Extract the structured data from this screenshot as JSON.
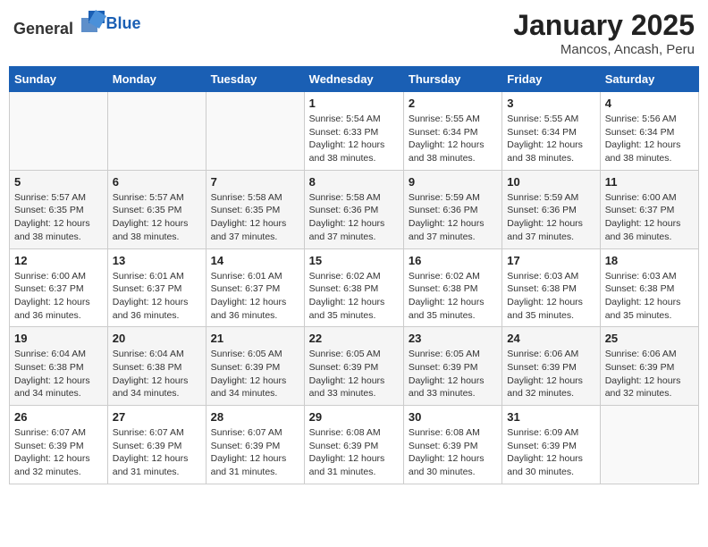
{
  "header": {
    "logo_general": "General",
    "logo_blue": "Blue",
    "month": "January 2025",
    "location": "Mancos, Ancash, Peru"
  },
  "weekdays": [
    "Sunday",
    "Monday",
    "Tuesday",
    "Wednesday",
    "Thursday",
    "Friday",
    "Saturday"
  ],
  "weeks": [
    [
      {
        "day": "",
        "info": ""
      },
      {
        "day": "",
        "info": ""
      },
      {
        "day": "",
        "info": ""
      },
      {
        "day": "1",
        "info": "Sunrise: 5:54 AM\nSunset: 6:33 PM\nDaylight: 12 hours\nand 38 minutes."
      },
      {
        "day": "2",
        "info": "Sunrise: 5:55 AM\nSunset: 6:34 PM\nDaylight: 12 hours\nand 38 minutes."
      },
      {
        "day": "3",
        "info": "Sunrise: 5:55 AM\nSunset: 6:34 PM\nDaylight: 12 hours\nand 38 minutes."
      },
      {
        "day": "4",
        "info": "Sunrise: 5:56 AM\nSunset: 6:34 PM\nDaylight: 12 hours\nand 38 minutes."
      }
    ],
    [
      {
        "day": "5",
        "info": "Sunrise: 5:57 AM\nSunset: 6:35 PM\nDaylight: 12 hours\nand 38 minutes."
      },
      {
        "day": "6",
        "info": "Sunrise: 5:57 AM\nSunset: 6:35 PM\nDaylight: 12 hours\nand 38 minutes."
      },
      {
        "day": "7",
        "info": "Sunrise: 5:58 AM\nSunset: 6:35 PM\nDaylight: 12 hours\nand 37 minutes."
      },
      {
        "day": "8",
        "info": "Sunrise: 5:58 AM\nSunset: 6:36 PM\nDaylight: 12 hours\nand 37 minutes."
      },
      {
        "day": "9",
        "info": "Sunrise: 5:59 AM\nSunset: 6:36 PM\nDaylight: 12 hours\nand 37 minutes."
      },
      {
        "day": "10",
        "info": "Sunrise: 5:59 AM\nSunset: 6:36 PM\nDaylight: 12 hours\nand 37 minutes."
      },
      {
        "day": "11",
        "info": "Sunrise: 6:00 AM\nSunset: 6:37 PM\nDaylight: 12 hours\nand 36 minutes."
      }
    ],
    [
      {
        "day": "12",
        "info": "Sunrise: 6:00 AM\nSunset: 6:37 PM\nDaylight: 12 hours\nand 36 minutes."
      },
      {
        "day": "13",
        "info": "Sunrise: 6:01 AM\nSunset: 6:37 PM\nDaylight: 12 hours\nand 36 minutes."
      },
      {
        "day": "14",
        "info": "Sunrise: 6:01 AM\nSunset: 6:37 PM\nDaylight: 12 hours\nand 36 minutes."
      },
      {
        "day": "15",
        "info": "Sunrise: 6:02 AM\nSunset: 6:38 PM\nDaylight: 12 hours\nand 35 minutes."
      },
      {
        "day": "16",
        "info": "Sunrise: 6:02 AM\nSunset: 6:38 PM\nDaylight: 12 hours\nand 35 minutes."
      },
      {
        "day": "17",
        "info": "Sunrise: 6:03 AM\nSunset: 6:38 PM\nDaylight: 12 hours\nand 35 minutes."
      },
      {
        "day": "18",
        "info": "Sunrise: 6:03 AM\nSunset: 6:38 PM\nDaylight: 12 hours\nand 35 minutes."
      }
    ],
    [
      {
        "day": "19",
        "info": "Sunrise: 6:04 AM\nSunset: 6:38 PM\nDaylight: 12 hours\nand 34 minutes."
      },
      {
        "day": "20",
        "info": "Sunrise: 6:04 AM\nSunset: 6:38 PM\nDaylight: 12 hours\nand 34 minutes."
      },
      {
        "day": "21",
        "info": "Sunrise: 6:05 AM\nSunset: 6:39 PM\nDaylight: 12 hours\nand 34 minutes."
      },
      {
        "day": "22",
        "info": "Sunrise: 6:05 AM\nSunset: 6:39 PM\nDaylight: 12 hours\nand 33 minutes."
      },
      {
        "day": "23",
        "info": "Sunrise: 6:05 AM\nSunset: 6:39 PM\nDaylight: 12 hours\nand 33 minutes."
      },
      {
        "day": "24",
        "info": "Sunrise: 6:06 AM\nSunset: 6:39 PM\nDaylight: 12 hours\nand 32 minutes."
      },
      {
        "day": "25",
        "info": "Sunrise: 6:06 AM\nSunset: 6:39 PM\nDaylight: 12 hours\nand 32 minutes."
      }
    ],
    [
      {
        "day": "26",
        "info": "Sunrise: 6:07 AM\nSunset: 6:39 PM\nDaylight: 12 hours\nand 32 minutes."
      },
      {
        "day": "27",
        "info": "Sunrise: 6:07 AM\nSunset: 6:39 PM\nDaylight: 12 hours\nand 31 minutes."
      },
      {
        "day": "28",
        "info": "Sunrise: 6:07 AM\nSunset: 6:39 PM\nDaylight: 12 hours\nand 31 minutes."
      },
      {
        "day": "29",
        "info": "Sunrise: 6:08 AM\nSunset: 6:39 PM\nDaylight: 12 hours\nand 31 minutes."
      },
      {
        "day": "30",
        "info": "Sunrise: 6:08 AM\nSunset: 6:39 PM\nDaylight: 12 hours\nand 30 minutes."
      },
      {
        "day": "31",
        "info": "Sunrise: 6:09 AM\nSunset: 6:39 PM\nDaylight: 12 hours\nand 30 minutes."
      },
      {
        "day": "",
        "info": ""
      }
    ]
  ]
}
